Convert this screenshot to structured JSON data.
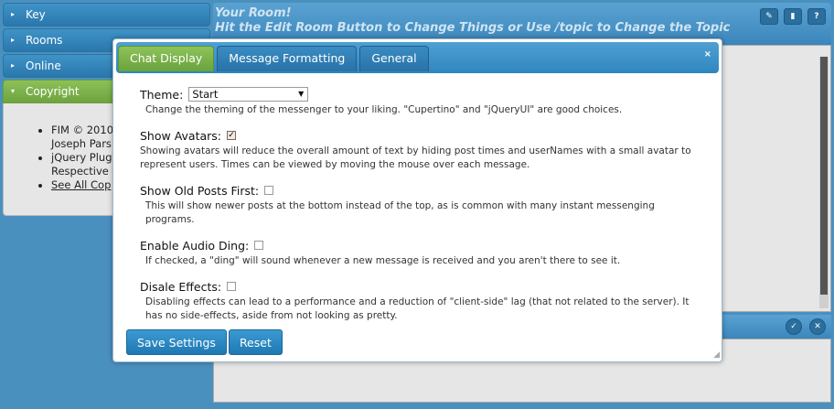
{
  "accordion": {
    "items": [
      {
        "label": "Key"
      },
      {
        "label": "Rooms"
      },
      {
        "label": "Online"
      },
      {
        "label": "Copyright"
      }
    ],
    "copyright_list": [
      "FIM © 2010",
      "Joseph Pars",
      "jQuery Plug",
      "Respective",
      "See All Cop"
    ]
  },
  "room": {
    "title": "Your Room!",
    "subtitle": "Hit the Edit Room Button to Change Things or Use /topic to Change the Topic",
    "tools": [
      "wrench-icon",
      "trash-icon",
      "help-icon"
    ]
  },
  "dialog": {
    "tabs": [
      "Chat Display",
      "Message Formatting",
      "General"
    ],
    "close_glyph": "×",
    "theme": {
      "label": "Theme:",
      "selected": "Start",
      "description": "Change the theming of the messenger to your liking. \"Cupertino\" and \"jQueryUI\" are good choices."
    },
    "avatars": {
      "label": "Show Avatars:",
      "checked": true,
      "description": "Showing avatars will reduce the overall amount of text by hiding post times and userNames with a small avatar to represent users. Times can be viewed by moving the mouse over each message."
    },
    "old_posts": {
      "label": "Show Old Posts First:",
      "checked": false,
      "description": "This will show newer posts at the bottom instead of the top, as is common with many instant messenging programs."
    },
    "audio": {
      "label": "Enable Audio Ding:",
      "checked": false,
      "description": "If checked, a \"ding\" will sound whenever a new message is received and you aren't there to see it."
    },
    "effects": {
      "label": "Disale Effects:",
      "checked": false,
      "description": "Disabling effects can lead to a performance and a reduction of \"client-side\" lag (that not related to the server). It has no side-effects, aside from not looking as pretty."
    },
    "buttons": {
      "save": "Save Settings",
      "reset": "Reset"
    }
  }
}
